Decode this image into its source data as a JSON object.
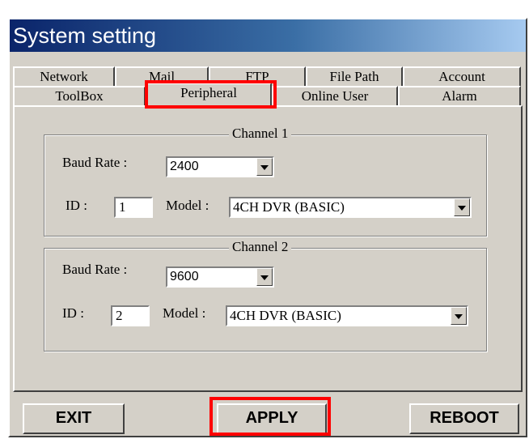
{
  "window": {
    "title": "System setting"
  },
  "tabs": {
    "row1": [
      "Network",
      "Mail",
      "FTP",
      "File Path",
      "Account"
    ],
    "row2": [
      "ToolBox",
      "Peripheral",
      "Online User",
      "Alarm"
    ],
    "active": "Peripheral"
  },
  "channel1": {
    "title": "Channel 1",
    "baud_label": "Baud Rate :",
    "baud_value": "2400",
    "id_label": "ID :",
    "id_value": "1",
    "model_label": "Model :",
    "model_value": "4CH DVR (BASIC)"
  },
  "channel2": {
    "title": "Channel 2",
    "baud_label": "Baud Rate :",
    "baud_value": "9600",
    "id_label": "ID :",
    "id_value": "2",
    "model_label": "Model :",
    "model_value": "4CH DVR (BASIC)"
  },
  "buttons": {
    "exit": "EXIT",
    "apply": "APPLY",
    "reboot": "REBOOT"
  },
  "colors": {
    "highlight": "#ff0000",
    "titlebar": "#0a246a",
    "face": "#d4d0c8"
  }
}
